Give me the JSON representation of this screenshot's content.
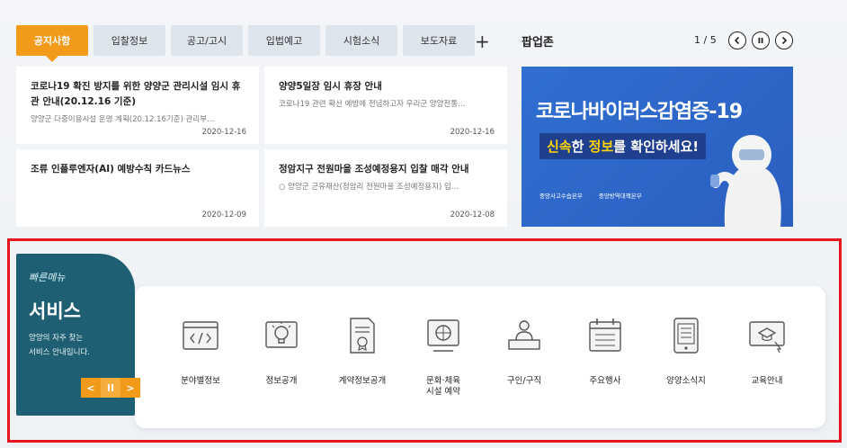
{
  "tabs": [
    {
      "label": "공지사항",
      "active": true
    },
    {
      "label": "입찰정보"
    },
    {
      "label": "공고/고시"
    },
    {
      "label": "입법예고"
    },
    {
      "label": "시험소식"
    },
    {
      "label": "보도자료"
    }
  ],
  "tabs_more": "+",
  "news": [
    {
      "title": "코로나19 확진 방지를 위한 양양군 관리시설 임시 휴관 안내(20.12.16 기준)",
      "summary": "양양군 다중이용시설 운영 계획(20.12.16기준) 관리부…",
      "date": "2020-12-16"
    },
    {
      "title": "양양5일장 임시 휴장 안내",
      "summary": "코로나19 관련 확산 예방에 전념하고자 우리군 양양전통…",
      "date": "2020-12-16"
    },
    {
      "title": "조류 인플루엔자(AI) 예방수칙 카드뉴스",
      "summary": "",
      "date": "2020-12-09"
    },
    {
      "title": "정암지구 전원마을 조성예정용지 입찰 매각 안내",
      "summary": "○ 양양군 군유재산(정암리 전원마을 조성예정용지) 입…",
      "date": "2020-12-08"
    }
  ],
  "popup": {
    "title": "팝업존",
    "counter": "1 / 5",
    "prev_icon": "chevron-left-icon",
    "pause_icon": "pause-icon",
    "next_icon": "chevron-right-icon",
    "banner_line1": "코로나바이러스감염증-19",
    "banner_highlight1": "신속",
    "banner_mid": "한 ",
    "banner_highlight2": "정보",
    "banner_rest": "를 확인하세요!",
    "org1": "중앙사고수습본부",
    "org2": "중앙방역대책본부"
  },
  "service": {
    "script": "빠른메뉴",
    "title": "서비스",
    "desc_line1": "양양의 자주 찾는",
    "desc_line2": "서비스 안내입니다.",
    "prev": "<",
    "pause": "II",
    "next": ">"
  },
  "menu": [
    {
      "label": "분야별정보",
      "icon": "code-window-icon"
    },
    {
      "label": "정보공개",
      "icon": "lightbulb-icon"
    },
    {
      "label": "계약정보공개",
      "icon": "contract-document-icon"
    },
    {
      "label": "문화·체육\n시설 예약",
      "icon": "basketball-board-icon"
    },
    {
      "label": "구인/구직",
      "icon": "person-desk-icon"
    },
    {
      "label": "주요행사",
      "icon": "calendar-icon"
    },
    {
      "label": "양양소식지",
      "icon": "tablet-document-icon"
    },
    {
      "label": "교육안내",
      "icon": "graduation-screen-icon"
    }
  ],
  "colors": {
    "accent": "#f29a1a",
    "service_bg": "#1f5f73",
    "banner_bg": "#2f6fd1",
    "highlight_border": "#e8171f"
  }
}
